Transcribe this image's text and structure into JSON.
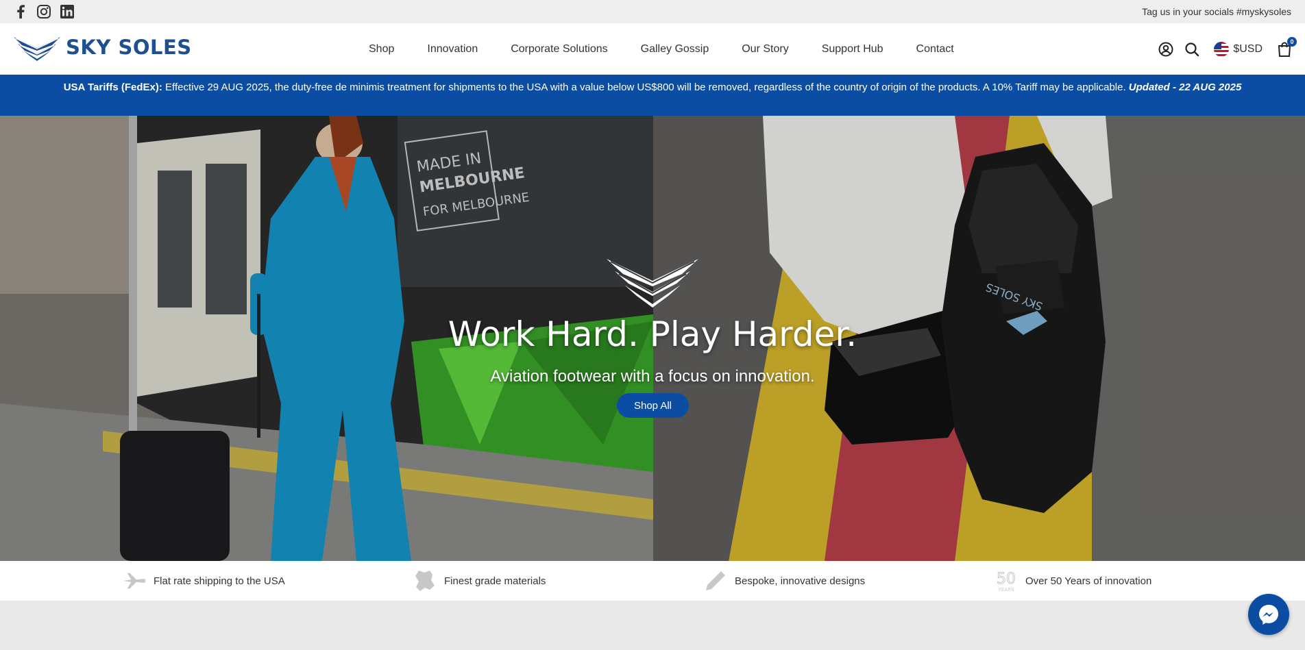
{
  "topbar": {
    "socials": [
      "facebook-icon",
      "instagram-icon",
      "linkedin-icon"
    ],
    "tagline": "Tag us in your socials #myskysoles"
  },
  "header": {
    "logo_text": "SKY SOLES",
    "nav": [
      "Shop",
      "Innovation",
      "Corporate Solutions",
      "Galley Gossip",
      "Our Story",
      "Support Hub",
      "Contact"
    ],
    "currency": "$USD",
    "cart_count": "0"
  },
  "announcement": {
    "lead": "USA Tariffs (FedEx):",
    "body": " Effective 29 AUG 2025, the duty-free de minimis treatment for shipments to the USA with a value below US$800 will be removed, regardless of the country of origin of the products. A 10% Tariff may be applicable. ",
    "updated": "Updated - 22 AUG 2025"
  },
  "hero": {
    "title": "Work Hard. Play Harder.",
    "subtitle": "Aviation footwear with a focus on innovation.",
    "button": "Shop All",
    "sign_text": "MADE IN MELBOURNE FOR MELBOURNE",
    "sole_text": "SKY SOLES"
  },
  "features": [
    {
      "icon": "airplane-icon",
      "label": "Flat rate shipping to the USA"
    },
    {
      "icon": "leather-hide-icon",
      "label": "Finest grade materials"
    },
    {
      "icon": "pencil-icon",
      "label": "Bespoke, innovative designs"
    },
    {
      "icon": "fifty-years-icon",
      "label": "Over 50 Years of innovation",
      "badge": "50",
      "badge_sub": "YEARS"
    }
  ],
  "colors": {
    "brand": "#0b4da2",
    "logo": "#1f4f8f"
  }
}
